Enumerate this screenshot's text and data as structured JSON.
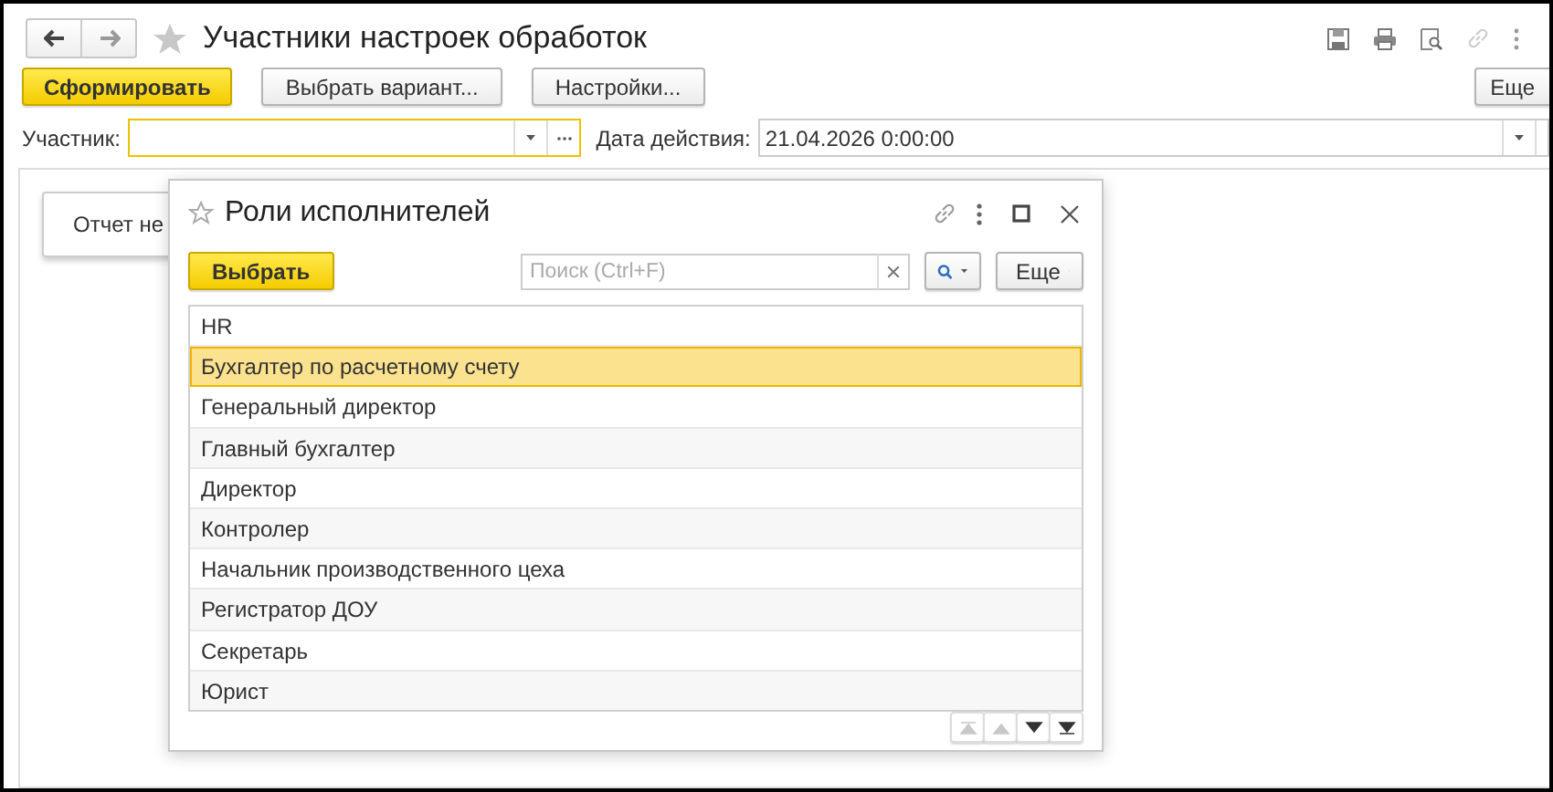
{
  "window": {
    "title": "Участники настроек обработок"
  },
  "toolbar": {
    "buttons": [
      {
        "label": "Сформировать",
        "kind": "primary"
      },
      {
        "label": "Выбрать вариант...",
        "kind": "normal"
      },
      {
        "label": "Настройки...",
        "kind": "normal"
      }
    ],
    "more": "Еще"
  },
  "filters": {
    "participant": {
      "label": "Участник:"
    },
    "date": {
      "label": "Дата действия:",
      "value": "21.04.2026  0:00:00"
    }
  },
  "report": {
    "message": "Отчет не"
  },
  "dialog": {
    "title": "Роли исполнителей",
    "select_button": "Выбрать",
    "search": {
      "placeholder": "Поиск (Ctrl+F)"
    },
    "more": "Еще",
    "items": [
      {
        "label": "HR",
        "selected": false
      },
      {
        "label": "Бухгалтер по расчетному счету",
        "selected": true
      },
      {
        "label": "Генеральный директор",
        "selected": false
      },
      {
        "label": "Главный бухгалтер",
        "selected": false
      },
      {
        "label": "Директор",
        "selected": false
      },
      {
        "label": "Контролер",
        "selected": false
      },
      {
        "label": "Начальник производственного цеха",
        "selected": false
      },
      {
        "label": "Регистратор ДОУ",
        "selected": false
      },
      {
        "label": "Секретарь",
        "selected": false
      },
      {
        "label": "Юрист",
        "selected": false
      }
    ],
    "nav": [
      {
        "kind": "first",
        "disabled": true
      },
      {
        "kind": "up",
        "disabled": true
      },
      {
        "kind": "down",
        "disabled": false
      },
      {
        "kind": "last",
        "disabled": false
      }
    ]
  }
}
